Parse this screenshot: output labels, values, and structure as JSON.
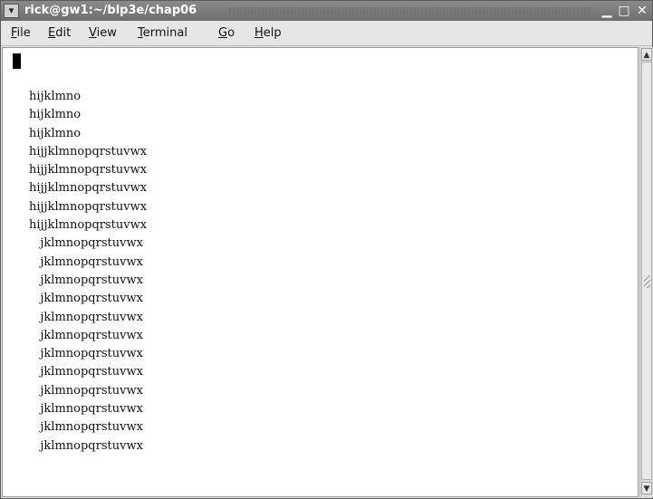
{
  "window": {
    "title": "rick@gw1:~/blp3e/chap06",
    "controls": {
      "menu_icon": "chevron-down-icon",
      "minimize_glyph": "▁",
      "maximize_glyph": "□",
      "close_glyph": "✕"
    }
  },
  "menubar": {
    "items": [
      {
        "mnemonic": "F",
        "rest": "ile"
      },
      {
        "mnemonic": "E",
        "rest": "dit"
      },
      {
        "mnemonic": "V",
        "rest": "iew"
      },
      {
        "mnemonic": "T",
        "rest": "erminal"
      },
      {
        "mnemonic": "G",
        "rest": "o"
      },
      {
        "mnemonic": "H",
        "rest": "elp"
      }
    ]
  },
  "terminal": {
    "lines": [
      "hijklmno",
      "hijklmno",
      "hijklmno",
      "hijjklmnopqrstuvwx",
      "hijjklmnopqrstuvwx",
      "hijjklmnopqrstuvwx",
      "hijjklmnopqrstuvwx",
      "hijjklmnopqrstuvwx",
      "   jklmnopqrstuvwx",
      "   jklmnopqrstuvwx",
      "   jklmnopqrstuvwx",
      "   jklmnopqrstuvwx",
      "   jklmnopqrstuvwx",
      "   jklmnopqrstuvwx",
      "   jklmnopqrstuvwx",
      "   jklmnopqrstuvwx",
      "   jklmnopqrstuvwx",
      "   jklmnopqrstuvwx",
      "   jklmnopqrstuvwx",
      "   jklmnopqrstuvwx"
    ]
  },
  "scrollbar": {
    "up_glyph": "▲",
    "down_glyph": "▼"
  }
}
